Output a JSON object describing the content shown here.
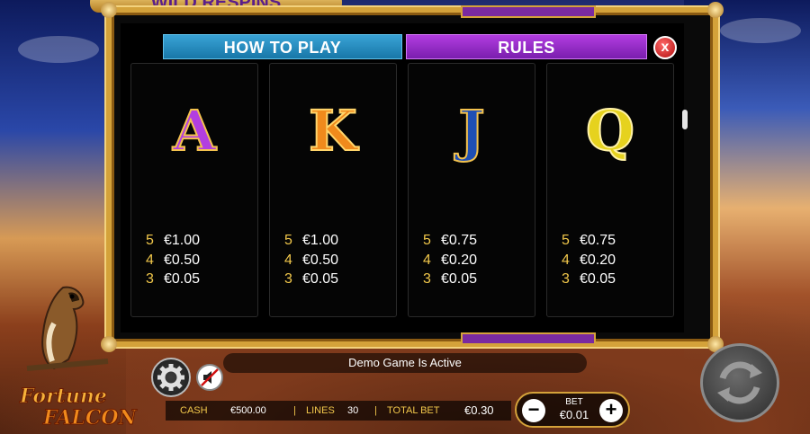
{
  "title_strip": "WILD RESPINS",
  "tabs": {
    "how_to_play": "HOW TO PLAY",
    "rules": "RULES"
  },
  "close_label": "x",
  "cards": [
    {
      "symbol": "A",
      "pays": [
        {
          "count": "5",
          "value": "€1.00"
        },
        {
          "count": "4",
          "value": "€0.50"
        },
        {
          "count": "3",
          "value": "€0.05"
        }
      ]
    },
    {
      "symbol": "K",
      "pays": [
        {
          "count": "5",
          "value": "€1.00"
        },
        {
          "count": "4",
          "value": "€0.50"
        },
        {
          "count": "3",
          "value": "€0.05"
        }
      ]
    },
    {
      "symbol": "J",
      "pays": [
        {
          "count": "5",
          "value": "€0.75"
        },
        {
          "count": "4",
          "value": "€0.20"
        },
        {
          "count": "3",
          "value": "€0.05"
        }
      ]
    },
    {
      "symbol": "Q",
      "pays": [
        {
          "count": "5",
          "value": "€0.75"
        },
        {
          "count": "4",
          "value": "€0.20"
        },
        {
          "count": "3",
          "value": "€0.05"
        }
      ]
    }
  ],
  "status": "Demo Game Is Active",
  "info": {
    "cash_label": "CASH",
    "cash_value": "€500.00",
    "lines_label": "LINES",
    "lines_value": "30",
    "total_bet_label": "TOTAL BET",
    "total_bet_value": "€0.30"
  },
  "bet": {
    "label": "BET",
    "value": "€0.01",
    "minus": "−",
    "plus": "+"
  },
  "logo": {
    "line1": "Fortune",
    "line2": "FALCON"
  },
  "icons": {
    "settings": "gear-icon",
    "sound": "speaker-muted-icon",
    "spin": "spin-arrows-icon",
    "close": "close-icon"
  },
  "colors": {
    "how_to_play_tab": "#1877a8",
    "rules_tab": "#7a1eae",
    "frame_gold": "#d4a23a",
    "pay_count": "#f2c84b"
  }
}
